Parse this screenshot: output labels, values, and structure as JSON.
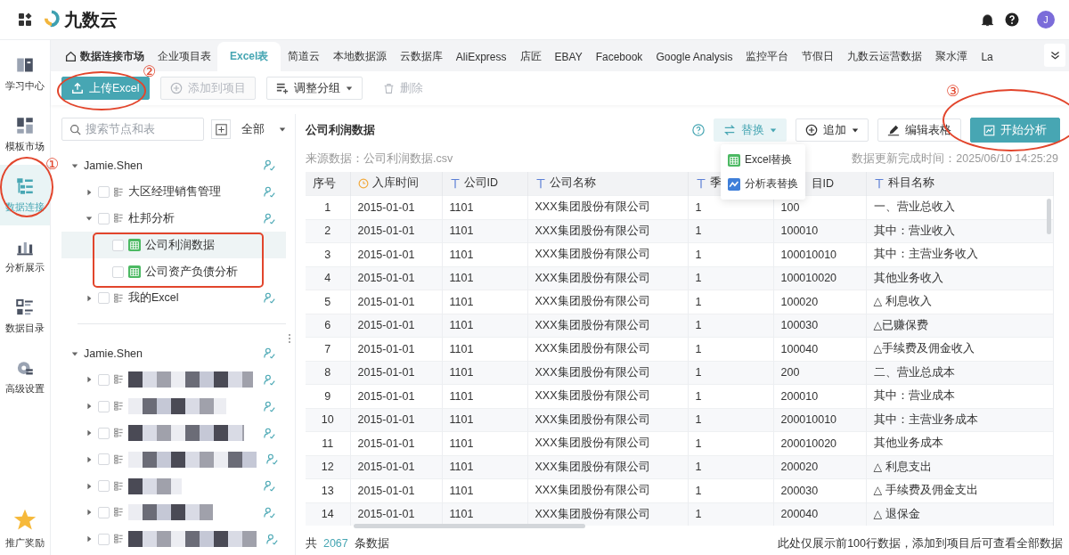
{
  "topbar": {
    "logo": "九数云",
    "avatar": "J"
  },
  "rail": [
    {
      "label": "学习中心",
      "selected": false
    },
    {
      "label": "模板市场",
      "selected": false
    },
    {
      "label": "数据连接",
      "selected": true
    },
    {
      "label": "分析展示",
      "selected": false
    },
    {
      "label": "数据目录",
      "selected": false
    },
    {
      "label": "高级设置",
      "selected": false
    }
  ],
  "rail_bottom": {
    "label": "推广奖励",
    "selected": false
  },
  "tabs": {
    "home": "数据连接市场",
    "items": [
      {
        "label": "企业项目表",
        "selected": false
      },
      {
        "label": "Excel表",
        "selected": true
      },
      {
        "label": "简道云",
        "selected": false
      },
      {
        "label": "本地数据源",
        "selected": false
      },
      {
        "label": "云数据库",
        "selected": false
      },
      {
        "label": "AliExpress",
        "selected": false
      },
      {
        "label": "店匠",
        "selected": false
      },
      {
        "label": "EBAY",
        "selected": false
      },
      {
        "label": "Facebook",
        "selected": false
      },
      {
        "label": "Google Analysis",
        "selected": false
      },
      {
        "label": "监控平台",
        "selected": false
      },
      {
        "label": "节假日",
        "selected": false
      },
      {
        "label": "九数云运营数据",
        "selected": false
      },
      {
        "label": "聚水潭",
        "selected": false
      },
      {
        "label": "La",
        "selected": false
      }
    ]
  },
  "toolbar": [
    {
      "label": "上传Excel",
      "kind": "primary",
      "disabled": false
    },
    {
      "label": "添加到项目",
      "kind": "default",
      "disabled": true
    },
    {
      "label": "调整分组",
      "kind": "dropdown",
      "disabled": false
    },
    {
      "label": "删除",
      "kind": "text",
      "disabled": true
    }
  ],
  "tree": {
    "search": {
      "placeholder": "搜索节点和表"
    },
    "filter": "全部",
    "groups": [
      {
        "label": "Jamie.Shen",
        "expanded": true,
        "children": [
          {
            "kind": "folder",
            "label": "大区经理销售管理",
            "expanded": false,
            "checked": false,
            "selected": false
          },
          {
            "kind": "folder",
            "label": "杜邦分析",
            "expanded": true,
            "checked": false,
            "selected": false,
            "children": [
              {
                "kind": "table",
                "label": "公司利润数据",
                "checked": false,
                "selected": true
              },
              {
                "kind": "table",
                "label": "公司资产负债分析",
                "checked": false,
                "selected": false
              }
            ]
          },
          {
            "kind": "folder",
            "label": "我的Excel",
            "expanded": false,
            "checked": false,
            "selected": false
          }
        ]
      },
      {
        "label": "Jamie.Shen",
        "expanded": true,
        "children": [
          {
            "kind": "redacted",
            "expanded": false,
            "checked": false,
            "selected": false
          },
          {
            "kind": "redacted",
            "expanded": false,
            "checked": false,
            "selected": false
          },
          {
            "kind": "redacted",
            "expanded": false,
            "checked": false,
            "selected": false
          },
          {
            "kind": "redacted",
            "expanded": false,
            "checked": false,
            "selected": false
          },
          {
            "kind": "redacted",
            "expanded": false,
            "checked": false,
            "selected": false
          },
          {
            "kind": "redacted",
            "expanded": false,
            "checked": false,
            "selected": false
          },
          {
            "kind": "redacted",
            "expanded": false,
            "checked": false,
            "selected": false
          }
        ]
      }
    ]
  },
  "panel": {
    "title": "公司利润数据",
    "source": "来源数据：公司利润数据.csv",
    "updated": "数据更新完成时间：2025/06/10 14:25:29",
    "actions": [
      {
        "label": "替换",
        "kind": "dropdown",
        "expanded": true
      },
      {
        "label": "追加",
        "kind": "dropdown",
        "expanded": false
      },
      {
        "label": "编辑表格",
        "kind": "default",
        "expanded": false
      },
      {
        "label": "开始分析",
        "kind": "primary",
        "expanded": false
      }
    ],
    "menu": [
      {
        "label": "Excel替换"
      },
      {
        "label": "分析表替换"
      }
    ],
    "table": {
      "columns": [
        {
          "label": "序号",
          "kind": "plain"
        },
        {
          "label": "入库时间",
          "kind": "date"
        },
        {
          "label": "公司ID",
          "kind": "text"
        },
        {
          "label": "公司名称",
          "kind": "text"
        },
        {
          "label": "季",
          "kind": "text"
        },
        {
          "label": "目ID",
          "kind": "covered"
        },
        {
          "label": "科目名称",
          "kind": "text"
        }
      ],
      "rows": [
        [
          "1",
          "2015-01-01",
          "1101",
          "XXX集团股份有限公司",
          "1",
          "100",
          "一、营业总收入"
        ],
        [
          "2",
          "2015-01-01",
          "1101",
          "XXX集团股份有限公司",
          "1",
          "100010",
          "其中：营业收入"
        ],
        [
          "3",
          "2015-01-01",
          "1101",
          "XXX集团股份有限公司",
          "1",
          "100010010",
          "其中：主营业务收入"
        ],
        [
          "4",
          "2015-01-01",
          "1101",
          "XXX集团股份有限公司",
          "1",
          "100010020",
          "其他业务收入"
        ],
        [
          "5",
          "2015-01-01",
          "1101",
          "XXX集团股份有限公司",
          "1",
          "100020",
          "△ 利息收入"
        ],
        [
          "6",
          "2015-01-01",
          "1101",
          "XXX集团股份有限公司",
          "1",
          "100030",
          "△已赚保费"
        ],
        [
          "7",
          "2015-01-01",
          "1101",
          "XXX集团股份有限公司",
          "1",
          "100040",
          "△手续费及佣金收入"
        ],
        [
          "8",
          "2015-01-01",
          "1101",
          "XXX集团股份有限公司",
          "1",
          "200",
          "二、营业总成本"
        ],
        [
          "9",
          "2015-01-01",
          "1101",
          "XXX集团股份有限公司",
          "1",
          "200010",
          "其中：营业成本"
        ],
        [
          "10",
          "2015-01-01",
          "1101",
          "XXX集团股份有限公司",
          "1",
          "200010010",
          "其中：主营业务成本"
        ],
        [
          "11",
          "2015-01-01",
          "1101",
          "XXX集团股份有限公司",
          "1",
          "200010020",
          "其他业务成本"
        ],
        [
          "12",
          "2015-01-01",
          "1101",
          "XXX集团股份有限公司",
          "1",
          "200020",
          "△ 利息支出"
        ],
        [
          "13",
          "2015-01-01",
          "1101",
          "XXX集团股份有限公司",
          "1",
          "200030",
          "△ 手续费及佣金支出"
        ],
        [
          "14",
          "2015-01-01",
          "1101",
          "XXX集团股份有限公司",
          "1",
          "200040",
          "△ 退保金"
        ]
      ]
    },
    "footer": {
      "prefix": "共",
      "count": "2067",
      "suffix": "条数据",
      "note": "此处仅展示前100行数据，添加到项目后可查看全部数据"
    }
  },
  "annotations": [
    {
      "kind": "ellipse",
      "number": "①"
    },
    {
      "kind": "ellipse",
      "number": "②"
    },
    {
      "kind": "ellipse",
      "number": "③"
    },
    {
      "kind": "box"
    }
  ]
}
